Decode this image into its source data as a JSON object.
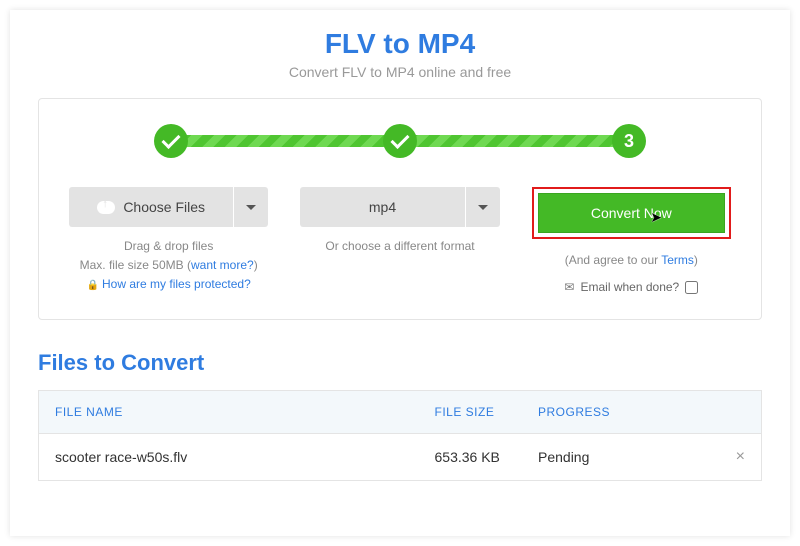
{
  "header": {
    "title": "FLV to MP4",
    "subtitle": "Convert FLV to MP4 online and free"
  },
  "steps": {
    "current": "3"
  },
  "chooseFiles": {
    "label": "Choose Files",
    "hint1": "Drag & drop files",
    "hint2_prefix": "Max. file size 50MB (",
    "hint2_link": "want more?",
    "hint2_suffix": ")",
    "protectLink": "How are my files protected?"
  },
  "format": {
    "value": "mp4",
    "hint": "Or choose a different format"
  },
  "convert": {
    "label": "Convert Now",
    "agree_prefix": "(And agree to our ",
    "agree_link": "Terms",
    "agree_suffix": ")",
    "emailLabel": "Email when done?"
  },
  "filesSection": {
    "titleA": "Files to ",
    "titleB": "Convert",
    "columns": {
      "name": "FILE NAME",
      "size": "FILE SIZE",
      "prog": "PROGRESS"
    },
    "rows": [
      {
        "name": "scooter race-w50s.flv",
        "size": "653.36 KB",
        "progress": "Pending"
      }
    ]
  }
}
